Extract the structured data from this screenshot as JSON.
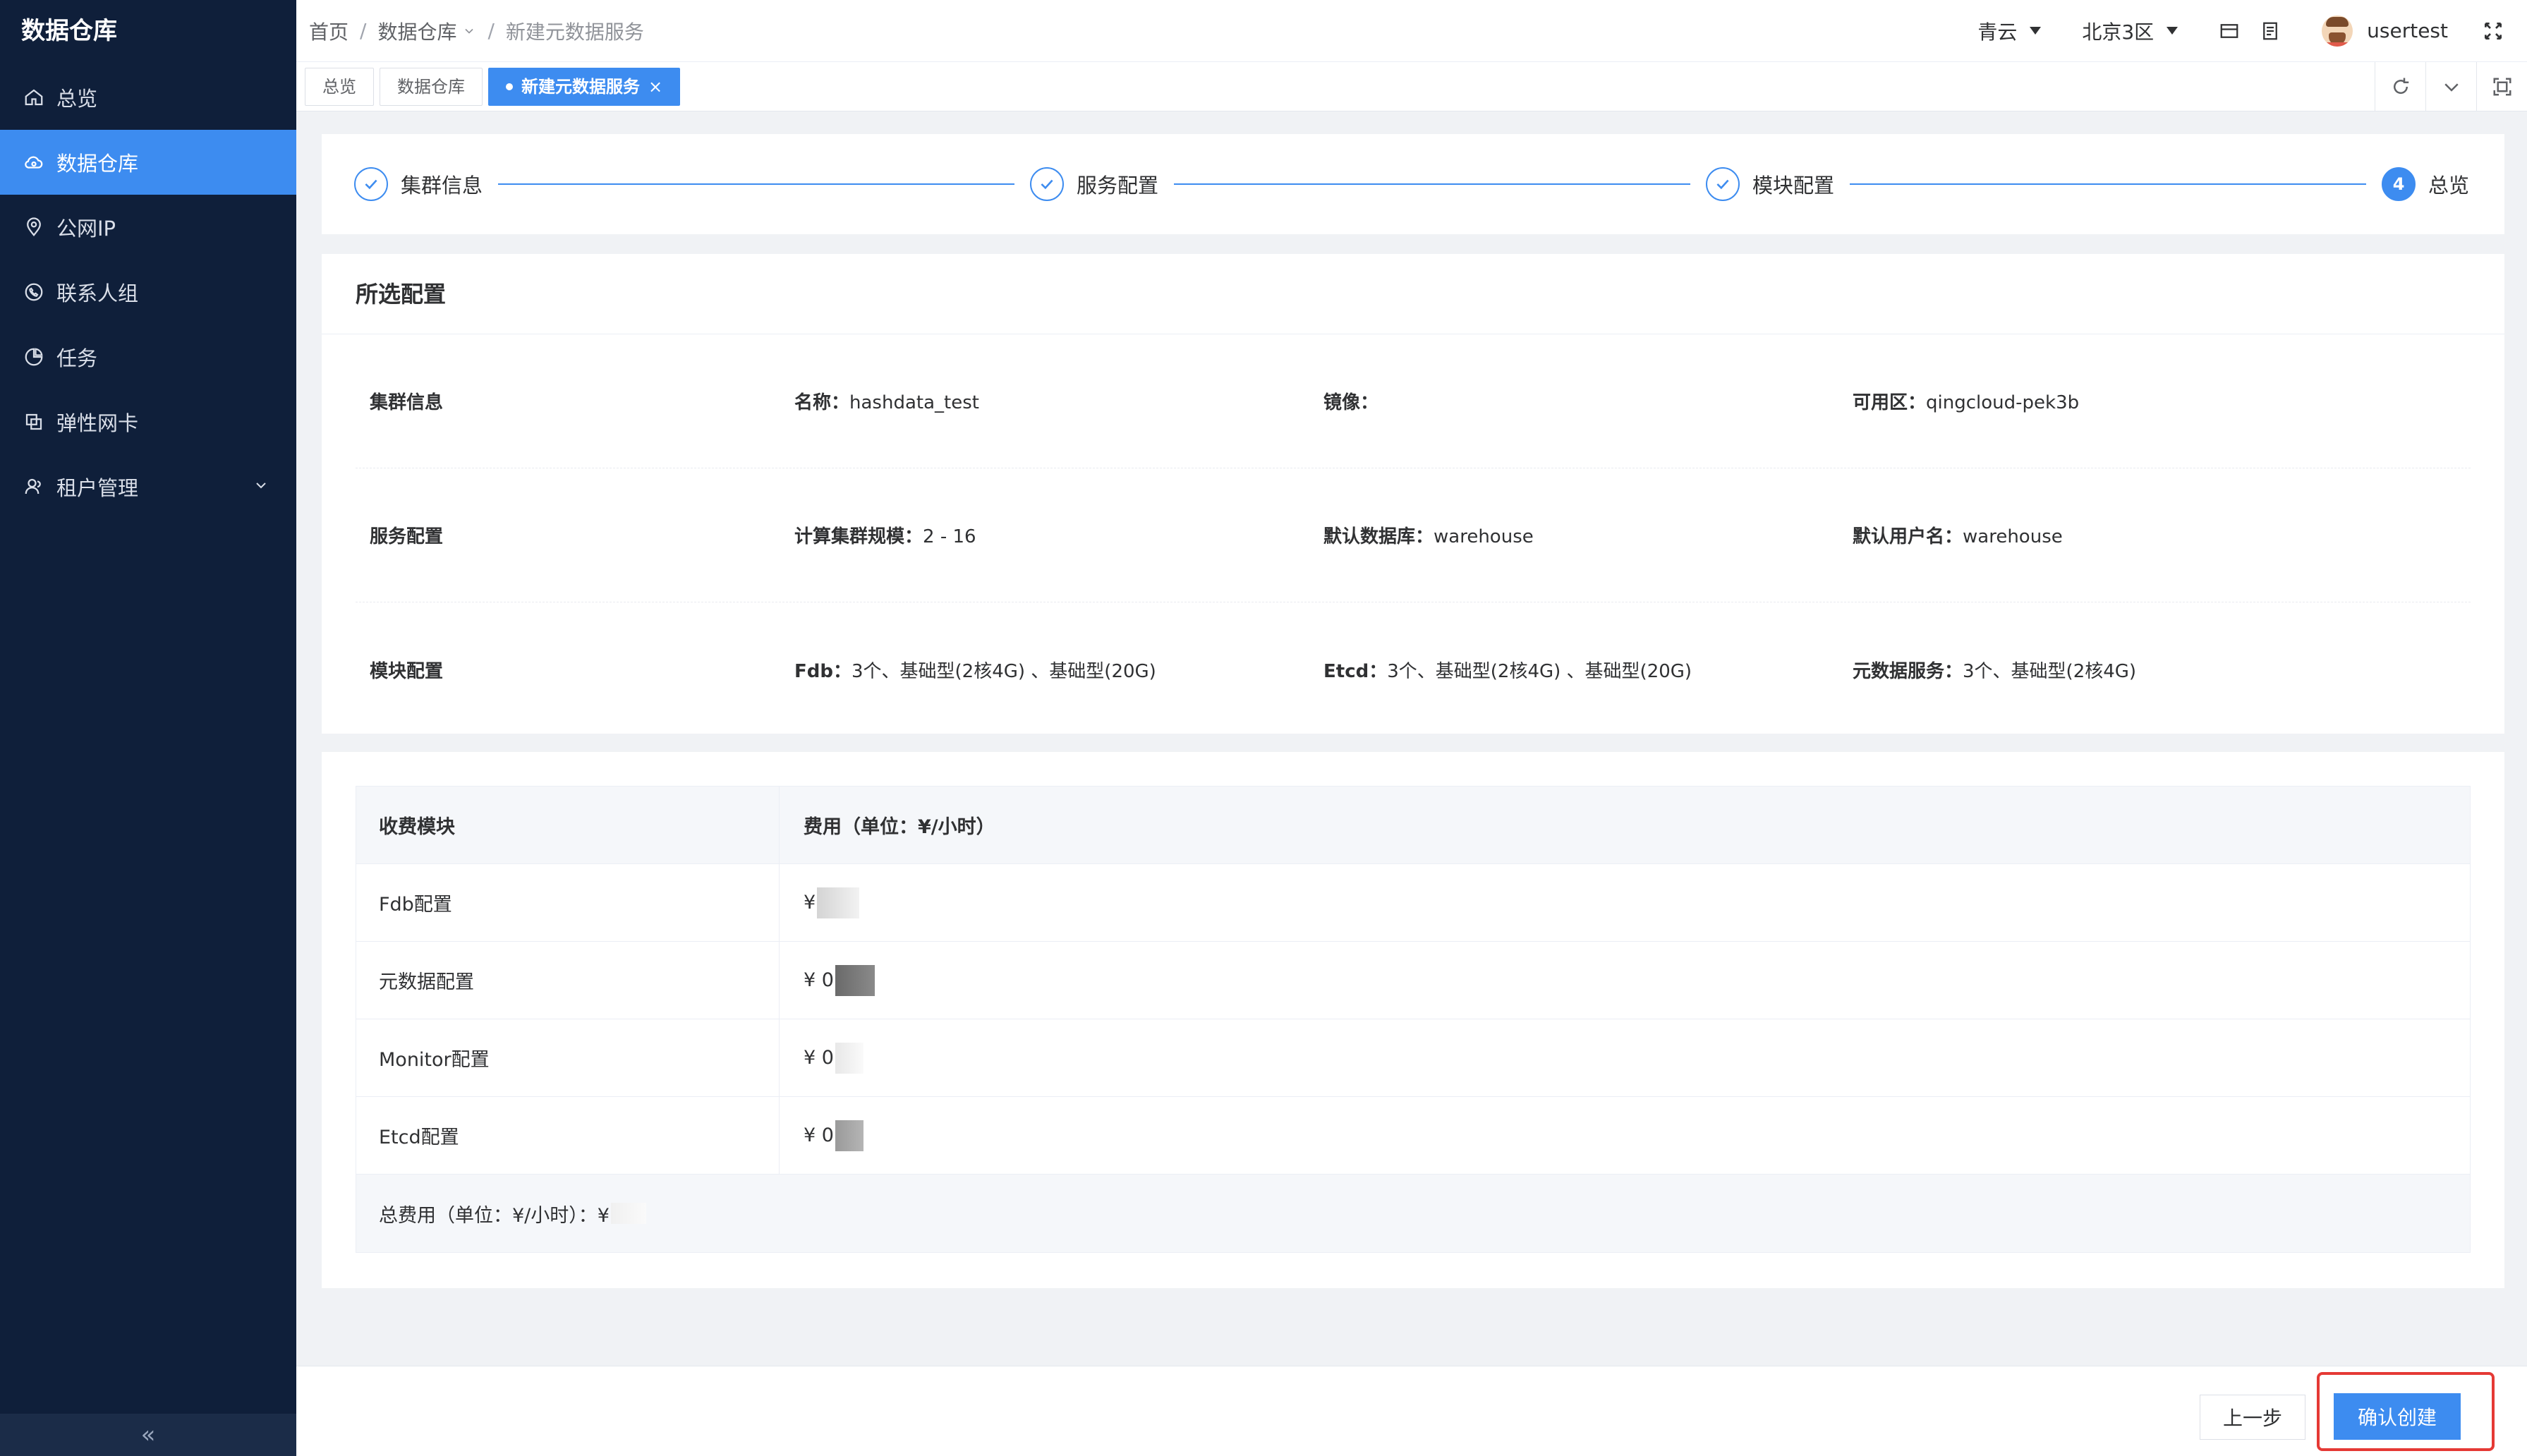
{
  "sidebar": {
    "title": "数据仓库",
    "items": [
      {
        "label": "总览",
        "icon": "home-icon"
      },
      {
        "label": "数据仓库",
        "icon": "cloud-icon",
        "active": true
      },
      {
        "label": "公网IP",
        "icon": "location-pin-icon"
      },
      {
        "label": "联系人组",
        "icon": "phone-chat-icon"
      },
      {
        "label": "任务",
        "icon": "pie-chart-icon"
      },
      {
        "label": "弹性网卡",
        "icon": "copy-icon"
      },
      {
        "label": "租户管理",
        "icon": "users-icon",
        "has_children": true
      }
    ],
    "collapse_glyph": "«"
  },
  "header": {
    "breadcrumb": [
      "首页",
      "数据仓库",
      "新建元数据服务"
    ],
    "provider": "青云",
    "region": "北京3区",
    "username": "usertest"
  },
  "tabs": [
    {
      "label": "总览"
    },
    {
      "label": "数据仓库"
    },
    {
      "label": "新建元数据服务",
      "active": true,
      "close": "×"
    }
  ],
  "steps": [
    {
      "label": "集群信息",
      "done": true
    },
    {
      "label": "服务配置",
      "done": true
    },
    {
      "label": "模块配置",
      "done": true
    },
    {
      "label": "总览",
      "number": "4"
    }
  ],
  "config": {
    "title": "所选配置",
    "rows": [
      {
        "label": "集群信息",
        "cells": [
          {
            "k": "名称：",
            "v": "hashdata_test"
          },
          {
            "k": "镜像：",
            "v": ""
          },
          {
            "k": "可用区：",
            "v": "qingcloud-pek3b"
          }
        ]
      },
      {
        "label": "服务配置",
        "cells": [
          {
            "k": "计算集群规模：",
            "v": "2 - 16"
          },
          {
            "k": "默认数据库：",
            "v": "warehouse"
          },
          {
            "k": "默认用户名：",
            "v": "warehouse"
          }
        ]
      },
      {
        "label": "模块配置",
        "cells": [
          {
            "k": "Fdb：",
            "v": "3个、基础型(2核4G) 、基础型(20G)"
          },
          {
            "k": "Etcd：",
            "v": "3个、基础型(2核4G) 、基础型(20G)"
          },
          {
            "k": "元数据服务：",
            "v": "3个、基础型(2核4G)"
          }
        ]
      }
    ]
  },
  "fees": {
    "header": [
      "收费模块",
      "费用（单位：¥/小时）"
    ],
    "rows": [
      {
        "module": "Fdb配置",
        "fee": "¥"
      },
      {
        "module": "元数据配置",
        "fee": "¥ 0"
      },
      {
        "module": "Monitor配置",
        "fee": "¥ 0"
      },
      {
        "module": "Etcd配置",
        "fee": "¥ 0"
      }
    ],
    "total_label": "总费用（单位：¥/小时）：¥"
  },
  "footer": {
    "prev_label": "上一步",
    "confirm_label": "确认创建"
  },
  "colors": {
    "primary": "#3d8cf0",
    "sidebar_bg": "#0f1f3a",
    "highlight": "#e53935"
  }
}
